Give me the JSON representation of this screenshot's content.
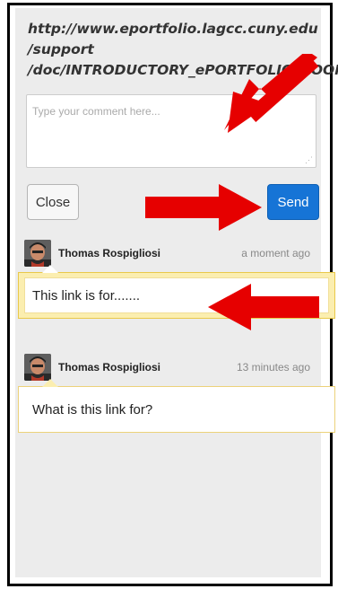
{
  "share": {
    "url_lines": [
      "http://www.eportfolio.lagcc.cuny.edu",
      "/support",
      "/doc/INTRODUCTORY_ePORTFOLIO_ROOM"
    ],
    "comment_placeholder": "Type your comment here...",
    "close_label": "Close",
    "send_label": "Send"
  },
  "comments": [
    {
      "author": "Thomas Rospigliosi",
      "time": "a moment ago",
      "text": "This link is for......."
    },
    {
      "author": "Thomas Rospigliosi",
      "time": "13 minutes ago",
      "text": "What is this link for?"
    }
  ],
  "colors": {
    "send_button": "#1674d6",
    "annotation_arrow": "#e60000",
    "highlight_border": "#e9c94a"
  }
}
